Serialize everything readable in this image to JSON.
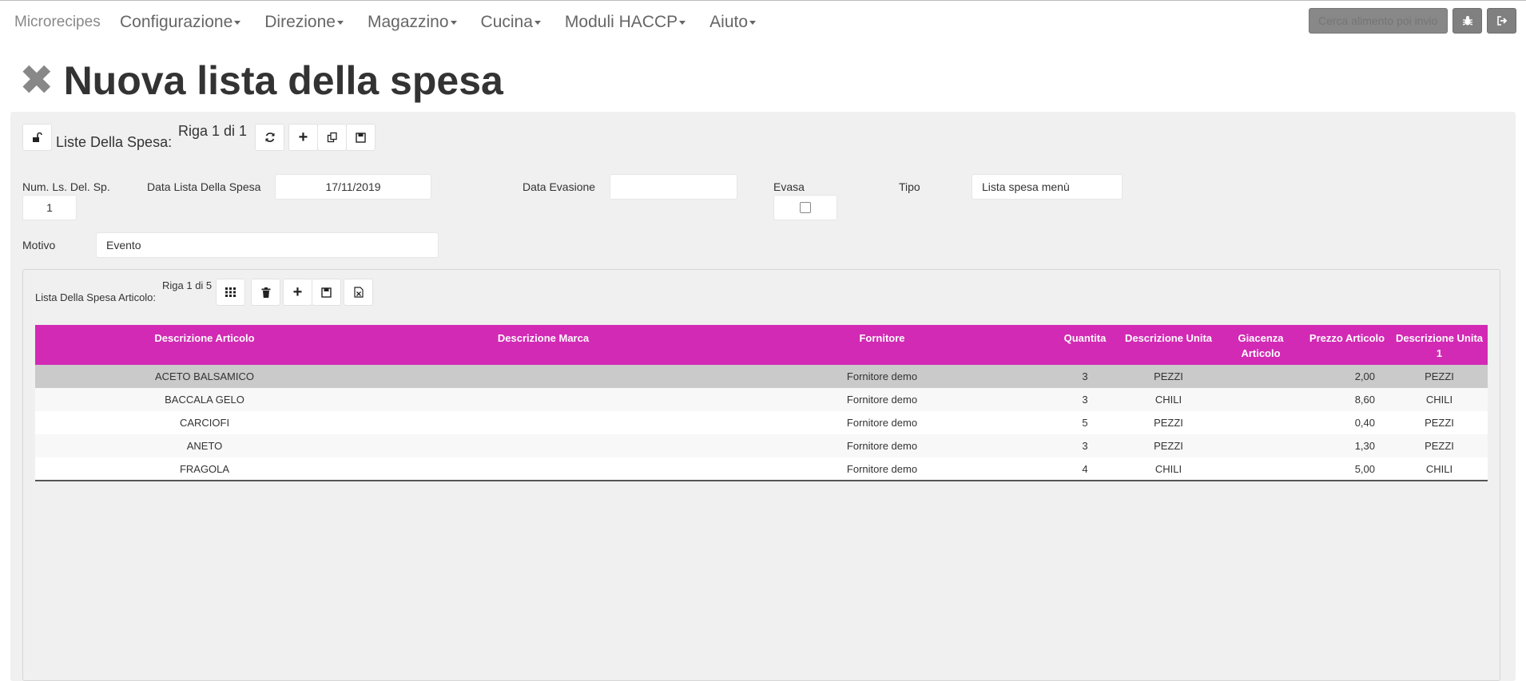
{
  "app": {
    "brand": "Microrecipes",
    "menu": [
      {
        "label": "Configurazione"
      },
      {
        "label": "Direzione"
      },
      {
        "label": "Magazzino"
      },
      {
        "label": "Cucina"
      },
      {
        "label": "Moduli HACCP"
      },
      {
        "label": "Aiuto"
      }
    ],
    "search": {
      "placeholder": "Cerca alimento poi invio"
    }
  },
  "page": {
    "title": "Nuova lista della spesa"
  },
  "master": {
    "label": "Liste Della Spesa:",
    "counter": "Riga 1 di 1",
    "fields": {
      "num_label": "Num. Ls. Del. Sp.",
      "num_value": "1",
      "data_label": "Data Lista Della Spesa",
      "data_value": "17/11/2019",
      "evasione_label": "Data Evasione",
      "evasione_value": "",
      "evasa_label": "Evasa",
      "evasa_checked": false,
      "tipo_label": "Tipo",
      "tipo_value": "Lista spesa menù",
      "motivo_label": "Motivo",
      "motivo_value": "Evento"
    }
  },
  "detail": {
    "label": "Lista Della Spesa Articolo:",
    "counter": "Riga 1 di 5",
    "columns": [
      "Descrizione Articolo",
      "Descrizione Marca",
      "Fornitore",
      "Quantita",
      "Descrizione Unita",
      "Giacenza Articolo",
      "Prezzo Articolo",
      "Descrizione Unita 1"
    ],
    "rows": [
      {
        "articolo": "ACETO BALSAMICO",
        "marca": "",
        "fornitore": "Fornitore demo",
        "quantita": "3",
        "unita": "PEZZI",
        "giacenza": "",
        "prezzo": "2,00",
        "unita1": "PEZZI"
      },
      {
        "articolo": "BACCALA GELO",
        "marca": "",
        "fornitore": "Fornitore demo",
        "quantita": "3",
        "unita": "CHILI",
        "giacenza": "",
        "prezzo": "8,60",
        "unita1": "CHILI"
      },
      {
        "articolo": "CARCIOFI",
        "marca": "",
        "fornitore": "Fornitore demo",
        "quantita": "5",
        "unita": "PEZZI",
        "giacenza": "",
        "prezzo": "0,40",
        "unita1": "PEZZI"
      },
      {
        "articolo": "ANETO",
        "marca": "",
        "fornitore": "Fornitore demo",
        "quantita": "3",
        "unita": "PEZZI",
        "giacenza": "",
        "prezzo": "1,30",
        "unita1": "PEZZI"
      },
      {
        "articolo": "FRAGOLA",
        "marca": "",
        "fornitore": "Fornitore demo",
        "quantita": "4",
        "unita": "CHILI",
        "giacenza": "",
        "prezzo": "5,00",
        "unita1": "CHILI"
      }
    ]
  },
  "colors": {
    "header": "#d22ab4",
    "selected_row": "#cacaca"
  }
}
